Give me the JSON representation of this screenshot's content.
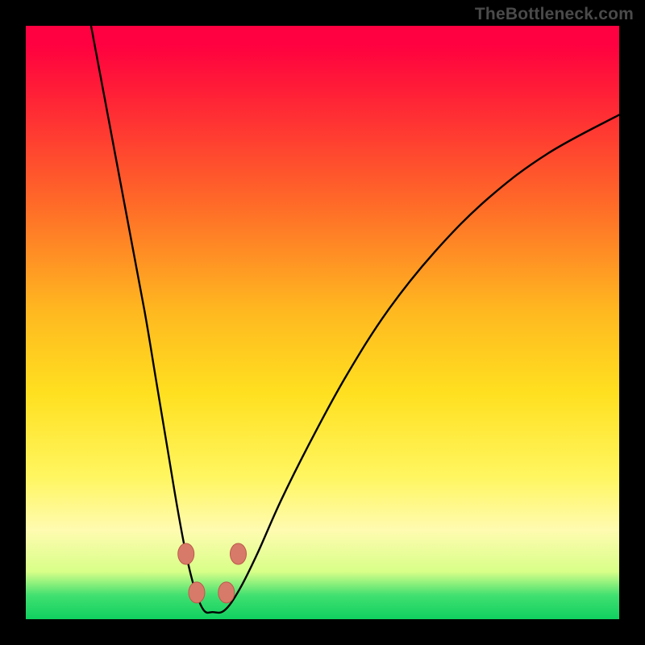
{
  "watermark": "TheBottleneck.com",
  "chart_data": {
    "type": "line",
    "title": "",
    "xlabel": "",
    "ylabel": "",
    "xlim": [
      0,
      100
    ],
    "ylim": [
      0,
      100
    ],
    "series": [
      {
        "name": "bottleneck-curve",
        "x": [
          11,
          14,
          17,
          20,
          22,
          24,
          25.5,
          27,
          28.5,
          30,
          31.5,
          33.5,
          36,
          39,
          43,
          48,
          54,
          61,
          69,
          78,
          88,
          100
        ],
        "values": [
          100,
          84,
          68,
          52,
          40,
          28,
          19,
          11,
          5,
          1.5,
          1.2,
          1.5,
          5,
          11,
          20,
          30,
          41,
          52,
          62,
          71,
          78.5,
          85
        ]
      }
    ],
    "markers": [
      {
        "name": "left-upper-dot",
        "x": 27.0,
        "y": 11.0
      },
      {
        "name": "right-upper-dot",
        "x": 35.8,
        "y": 11.0
      },
      {
        "name": "left-lower-dot",
        "x": 28.8,
        "y": 4.5
      },
      {
        "name": "right-lower-dot",
        "x": 33.8,
        "y": 4.5
      }
    ],
    "colors": {
      "curve": "#000000",
      "marker_fill": "#d87a6a",
      "marker_stroke": "#bb5a4a"
    }
  }
}
